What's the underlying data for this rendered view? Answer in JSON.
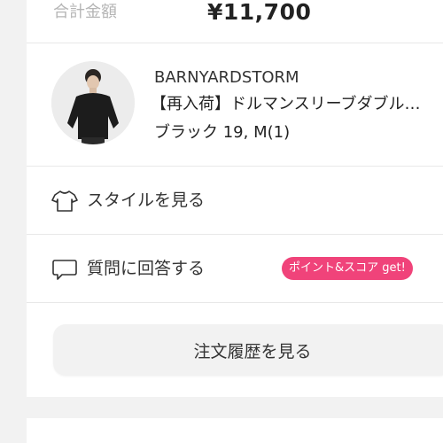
{
  "order": {
    "total_label": "合計金額",
    "total_value": "¥11,700"
  },
  "product": {
    "brand": "BARNYARDSTORM",
    "name": "【再入荷】ドルマンスリーブダブル…",
    "variant": "ブラック 19, M(1)"
  },
  "menu": {
    "style_label": "スタイルを見る",
    "style_icon": "tshirt-icon",
    "question_label": "質問に回答する",
    "question_icon": "speech-bubble-icon",
    "question_badge": "ポイント&スコア get!"
  },
  "buttons": {
    "order_history": "注文履歴を見る"
  },
  "colors": {
    "badge": "#f0437a",
    "background": "#f2f2f2"
  }
}
